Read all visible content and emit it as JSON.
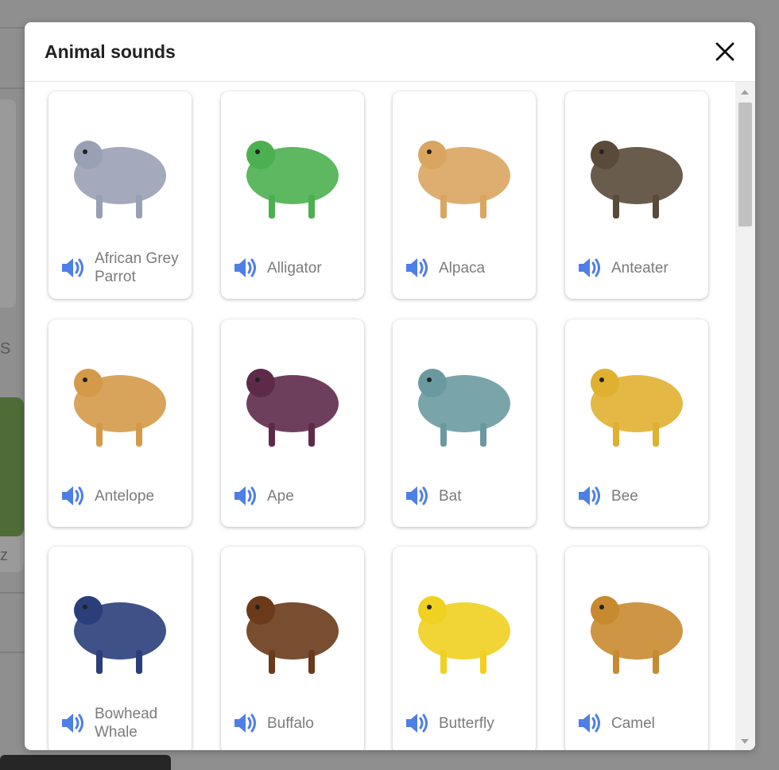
{
  "background": {
    "letters": [
      "S",
      "z"
    ]
  },
  "modal": {
    "title": "Animal sounds",
    "close_icon": "close-icon"
  },
  "animals": [
    {
      "name": "African Grey Parrot",
      "label_lines": [
        "African Grey",
        "Parrot"
      ],
      "color": "#9aa0b4"
    },
    {
      "name": "Alligator",
      "label_lines": [
        "Alligator"
      ],
      "color": "#4caf50"
    },
    {
      "name": "Alpaca",
      "label_lines": [
        "Alpaca"
      ],
      "color": "#d9a560"
    },
    {
      "name": "Anteater",
      "label_lines": [
        "Anteater"
      ],
      "color": "#5a4a3a"
    },
    {
      "name": "Antelope",
      "label_lines": [
        "Antelope"
      ],
      "color": "#d49a4a"
    },
    {
      "name": "Ape",
      "label_lines": [
        "Ape"
      ],
      "color": "#5e2a4a"
    },
    {
      "name": "Bat",
      "label_lines": [
        "Bat"
      ],
      "color": "#6a9aa0"
    },
    {
      "name": "Bee",
      "label_lines": [
        "Bee"
      ],
      "color": "#e0b030"
    },
    {
      "name": "Bowhead Whale",
      "label_lines": [
        "Bowhead",
        "Whale"
      ],
      "color": "#2a3f7a"
    },
    {
      "name": "Buffalo",
      "label_lines": [
        "Buffalo"
      ],
      "color": "#6a3a1a"
    },
    {
      "name": "Butterfly",
      "label_lines": [
        "Butterfly"
      ],
      "color": "#f0d020"
    },
    {
      "name": "Camel",
      "label_lines": [
        "Camel"
      ],
      "color": "#c88a30"
    }
  ],
  "sound_icon": "speaker-icon",
  "accent": "#4e7fe6"
}
